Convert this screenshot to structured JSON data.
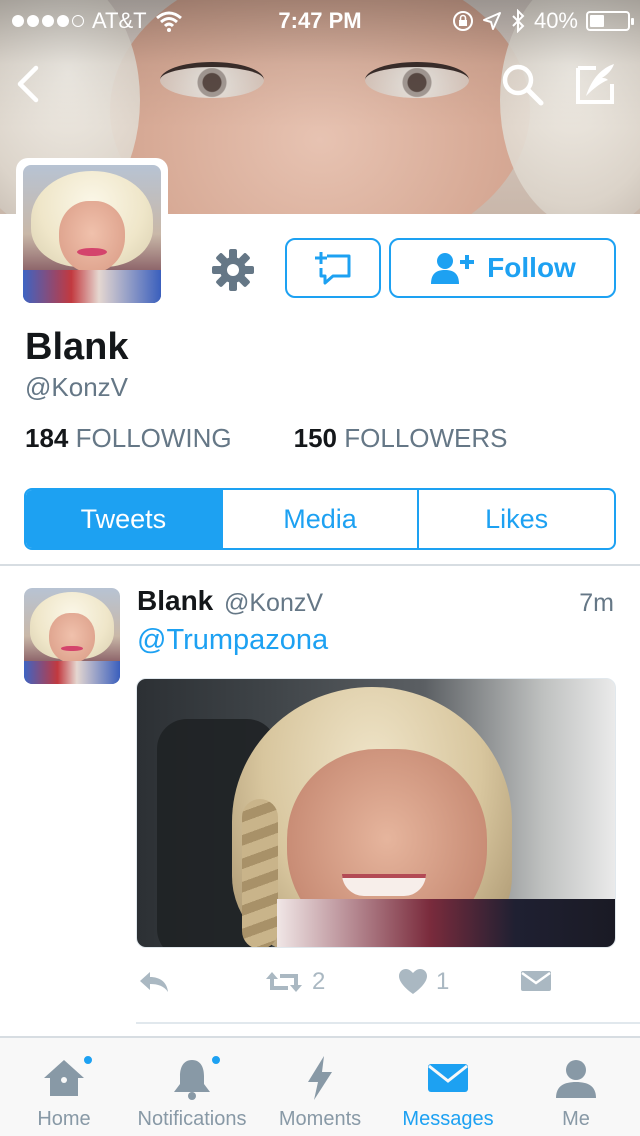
{
  "status_bar": {
    "carrier": "AT&T",
    "time": "7:47 PM",
    "battery": "40%",
    "battery_level": 0.4,
    "signal_bars": 4
  },
  "profile": {
    "display_name": "Blank",
    "handle": "@KonzV",
    "following_count": "184",
    "following_label": "FOLLOWING",
    "followers_count": "150",
    "followers_label": "FOLLOWERS",
    "follow_label": "Follow"
  },
  "tabs": [
    "Tweets",
    "Media",
    "Likes"
  ],
  "tweet": {
    "name": "Blank",
    "handle": "@KonzV",
    "time": "7m",
    "text": "@Trumpazona",
    "retweets": "2",
    "likes": "1"
  },
  "tabbar": [
    {
      "label": "Home",
      "icon": "home-icon",
      "badge": true
    },
    {
      "label": "Notifications",
      "icon": "bell-icon",
      "badge": true
    },
    {
      "label": "Moments",
      "icon": "lightning-icon",
      "badge": false
    },
    {
      "label": "Messages",
      "icon": "envelope-icon",
      "badge": false,
      "active": true
    },
    {
      "label": "Me",
      "icon": "person-icon",
      "badge": false
    }
  ],
  "colors": {
    "accent": "#1da1f2",
    "muted": "#657786",
    "icon_gray": "#aab8c2"
  }
}
